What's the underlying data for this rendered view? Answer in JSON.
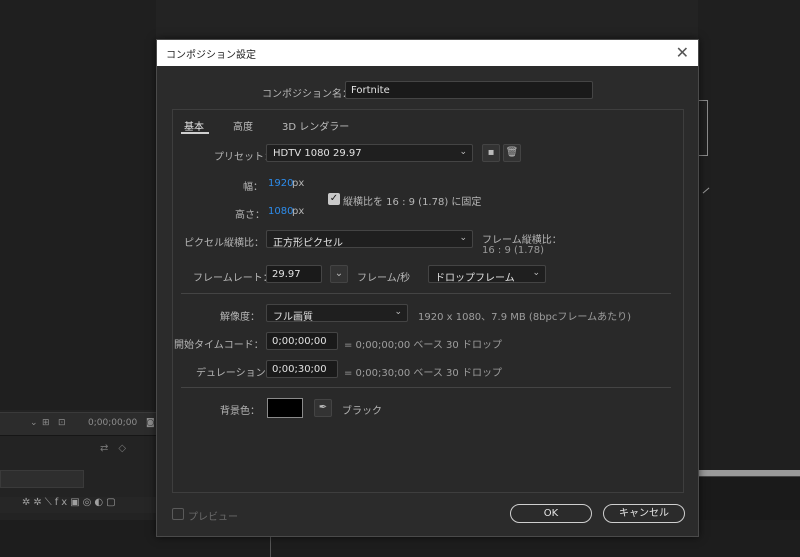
{
  "background": {
    "timecode": "0;00;00;00"
  },
  "dialog": {
    "title": "コンポジション設定",
    "comp_name_label": "コンポジション名：",
    "comp_name_value": "Fortnite",
    "tabs": [
      {
        "label": "基本",
        "active": true
      },
      {
        "label": "高度",
        "active": false
      },
      {
        "label": "3D レンダラー",
        "active": false
      }
    ],
    "preset": {
      "label": "プリセット：",
      "value": "HDTV 1080 29.97"
    },
    "width": {
      "label": "幅：",
      "value": "1920",
      "unit": "px"
    },
    "height": {
      "label": "高さ：",
      "value": "1080",
      "unit": "px"
    },
    "lock_aspect": {
      "checked": true,
      "label": "縦横比を 16 : 9 (1.78) に固定"
    },
    "pixel_aspect": {
      "label": "ピクセル縦横比：",
      "value": "正方形ピクセル"
    },
    "frame_aspect": {
      "label": "フレーム縦横比：",
      "value": "16 : 9 (1.78)"
    },
    "frame_rate": {
      "label": "フレームレート：",
      "value": "29.97",
      "unit": "フレーム/秒",
      "drop_frame": "ドロップフレーム"
    },
    "resolution": {
      "label": "解像度：",
      "value": "フル画質",
      "info": "1920 x 1080、7.9 MB (8bpcフレームあたり)"
    },
    "start_timecode": {
      "label": "開始タイムコード：",
      "value": "0;00;00;00",
      "info": "= 0;00;00;00  ベース 30  ドロップ"
    },
    "duration": {
      "label": "デュレーション：",
      "value": "0;00;30;00",
      "info": "= 0;00;30;00  ベース 30  ドロップ"
    },
    "bg_color": {
      "label": "背景色：",
      "color": "#000000",
      "name": "ブラック"
    },
    "preview_label": "プレビュー",
    "ok_label": "OK",
    "cancel_label": "キャンセル"
  }
}
